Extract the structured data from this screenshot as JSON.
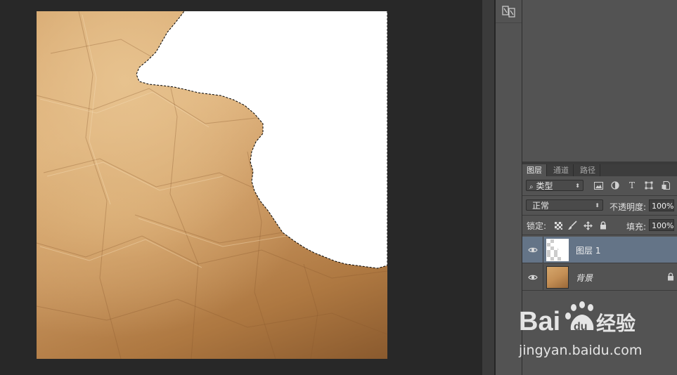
{
  "layers_panel": {
    "tabs": [
      "图层",
      "通道",
      "路径"
    ],
    "filter_kind": "类型",
    "blend_mode": "正常",
    "opacity_label": "不透明度:",
    "opacity_value": "100%",
    "lock_label": "锁定:",
    "fill_label": "填充:",
    "fill_value": "100%",
    "layers": [
      {
        "name": "图层 1",
        "selected": true,
        "visible": true,
        "locked": false
      },
      {
        "name": "背景",
        "selected": false,
        "visible": true,
        "locked": true
      }
    ]
  },
  "watermark": {
    "logo_text": "Bai",
    "logo_text_2": "du",
    "logo_cn": "经验",
    "url": "jingyan.baidu.com"
  },
  "colors": {
    "workspace_bg": "#282828",
    "panel_bg": "#535353",
    "selected_layer": "#647487",
    "paper_tone": "#d3a36a"
  }
}
